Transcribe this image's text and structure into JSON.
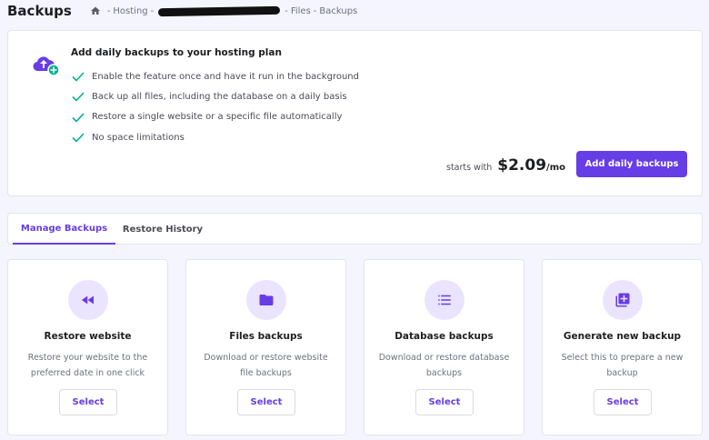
{
  "header": {
    "title": "Backups",
    "breadcrumb": [
      "Hosting",
      "Files",
      "Backups"
    ]
  },
  "upsell": {
    "title": "Add daily backups to your hosting plan",
    "features": [
      "Enable the feature once and have it run in the background",
      "Back up all files, including the database on a daily basis",
      "Restore a single website or a specific file automatically",
      "No space limitations"
    ],
    "price_prefix": "starts with",
    "price_value": "$2.09",
    "price_suffix": "/mo",
    "button_label": "Add daily backups"
  },
  "tabs": [
    {
      "label": "Manage Backups",
      "active": true
    },
    {
      "label": "Restore History",
      "active": false
    }
  ],
  "options": [
    {
      "icon": "rewind-icon",
      "title": "Restore website",
      "description": "Restore your website to the preferred date in one click",
      "button": "Select"
    },
    {
      "icon": "folder-icon",
      "title": "Files backups",
      "description": "Download or restore website file backups",
      "button": "Select"
    },
    {
      "icon": "list-icon",
      "title": "Database backups",
      "description": "Download or restore database backups",
      "button": "Select"
    },
    {
      "icon": "add-box-icon",
      "title": "Generate new backup",
      "description": "Select this to prepare a new backup",
      "button": "Select"
    }
  ],
  "colors": {
    "accent": "#673de6",
    "accent_light": "#ebe4ff",
    "success": "#00b090",
    "background": "#f4f5ff"
  }
}
